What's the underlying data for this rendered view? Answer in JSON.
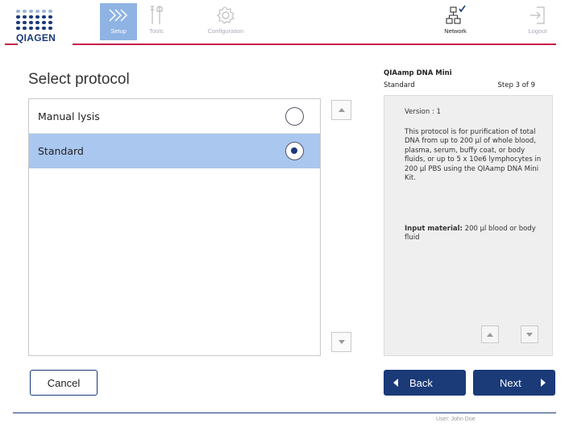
{
  "header": {
    "logo_text": "QIAGEN",
    "nav": [
      {
        "label": "Setup",
        "icon": "setup-chevrons-icon",
        "active": true
      },
      {
        "label": "Tools",
        "icon": "tools-icon",
        "active": false
      },
      {
        "label": "Configuration",
        "icon": "configuration-gear-icon",
        "active": false
      },
      {
        "label": "Network",
        "icon": "network-icon",
        "active": false
      },
      {
        "label": "Logout",
        "icon": "logout-icon",
        "active": false
      }
    ],
    "accent_color": "#c8194b",
    "brand_color": "#1a3a78"
  },
  "page": {
    "title": "Select protocol"
  },
  "protocols": [
    {
      "label": "Manual lysis",
      "selected": false
    },
    {
      "label": "Standard",
      "selected": true
    }
  ],
  "info": {
    "title": "QIAamp DNA Mini",
    "subtitle": "Standard",
    "step": "Step 3 of 9",
    "version": "Version : 1",
    "description": "This protocol is for purification of total DNA from up to 200 µl of whole blood, plasma, serum, buffy coat, or body fluids, or up to 5 x 10e6 lymphocytes in 200 µl PBS using the QIAamp DNA Mini Kit.",
    "input_label": "Input material:",
    "input_value": "200 µl blood or body fluid"
  },
  "buttons": {
    "cancel": "Cancel",
    "back": "Back",
    "next": "Next"
  },
  "footer": {
    "user": "User: John Doe"
  }
}
